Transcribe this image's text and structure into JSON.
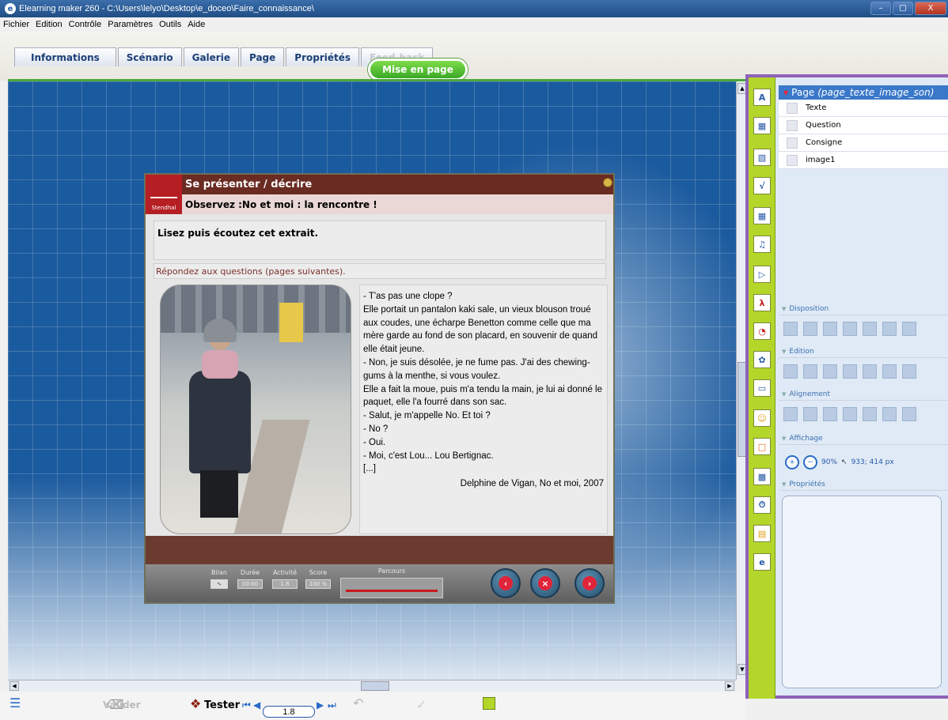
{
  "window": {
    "title": "Elearning maker 260 - C:\\Users\\lelyo\\Desktop\\e_doceo\\Faire_connaissance\\"
  },
  "menu": [
    "Fichier",
    "Edition",
    "Contrôle",
    "Paramètres",
    "Outils",
    "Aide"
  ],
  "tabs": [
    {
      "label": "Informations",
      "enabled": true
    },
    {
      "label": "Scénario",
      "enabled": true
    },
    {
      "label": "Galerie",
      "enabled": true
    },
    {
      "label": "Page",
      "enabled": true
    },
    {
      "label": "Propriétés",
      "enabled": true
    },
    {
      "label": "Feed-back",
      "enabled": false
    }
  ],
  "mode_button": "Mise en page",
  "slide": {
    "title": "Se présenter / décrire",
    "subtitle": "Observez :No et moi : la rencontre !",
    "logo_text": "Stendhal",
    "consigne": "Lisez puis écoutez cet extrait.",
    "question": "Répondez aux questions (pages suivantes).",
    "extract_lines": [
      "- T'as pas une clope ?",
      "Elle portait un pantalon kaki sale, un vieux blouson troué",
      "aux coudes, une écharpe Benetton comme celle que ma",
      "mère garde au fond de son placard, en souvenir de quand",
      "elle était jeune.",
      "- Non, je suis désolée, je ne fume pas. J'ai des chewing-",
      "gums à la menthe, si vous voulez.",
      "Elle a fait la moue, puis m'a tendu la main, je lui ai donné le",
      "paquet, elle l'a fourré dans son sac.",
      "- Salut, je m'appelle No. Et toi ?",
      "- No ?",
      "- Oui.",
      "- Moi, c'est Lou... Lou Bertignac.",
      "[...]"
    ],
    "author": "Delphine de Vigan, No et moi, 2007",
    "footer": {
      "bilan_label": "Bilan",
      "duree_label": "Durée",
      "duree_value": "00:00",
      "activite_label": "Activité",
      "activite_value": "1.8",
      "score_label": "Score",
      "score_value": "100 %",
      "parcours_label": "Parcours"
    }
  },
  "tree": {
    "root_label": "Page",
    "root_type": "(page_texte_image_son)",
    "items": [
      "Texte",
      "Question",
      "Consigne",
      "image1"
    ]
  },
  "panel": {
    "sections": [
      "Disposition",
      "Edition",
      "Alignement",
      "Affichage",
      "Propriétés"
    ],
    "zoom": "90%",
    "coords": "933; 414 px"
  },
  "toolstrip_icons": [
    "text-tool-icon",
    "image-tool-icon",
    "media-tool-icon",
    "formula-tool-icon",
    "table-tool-icon",
    "sound-tool-icon",
    "video-tool-icon",
    "pdf-tool-icon",
    "chart-tool-icon",
    "flash-tool-icon",
    "window-tool-icon",
    "smiley-tool-icon",
    "frame-tool-icon",
    "animation-tool-icon",
    "timer-tool-icon",
    "note-tool-icon",
    "web-tool-icon"
  ],
  "bottom": {
    "valider": "Valider",
    "tester": "Tester",
    "page_number": "1.8"
  }
}
